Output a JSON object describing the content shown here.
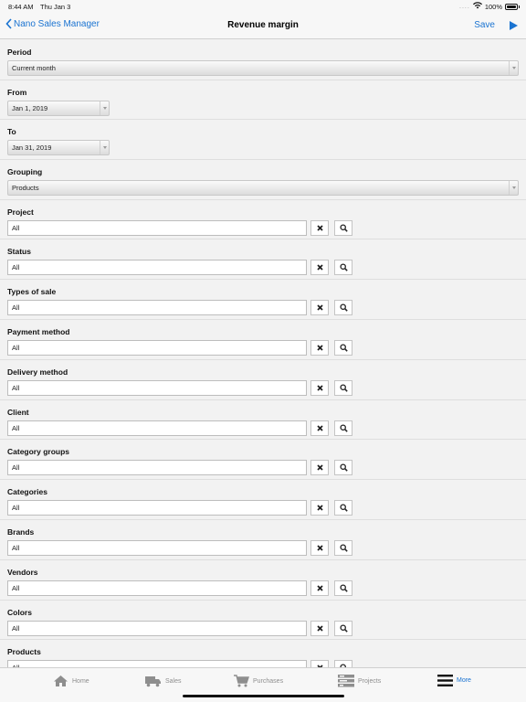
{
  "status_bar": {
    "time": "8:44 AM",
    "date": "Thu Jan 3",
    "battery": "100%"
  },
  "nav": {
    "back_label": "Nano Sales Manager",
    "title": "Revenue margin",
    "save_label": "Save"
  },
  "period": {
    "label": "Period",
    "value": "Current month"
  },
  "from": {
    "label": "From",
    "value": "Jan 1, 2019"
  },
  "to": {
    "label": "To",
    "value": "Jan 31, 2019"
  },
  "grouping": {
    "label": "Grouping",
    "value": "Products"
  },
  "filters": [
    {
      "label": "Project",
      "value": "All"
    },
    {
      "label": "Status",
      "value": "All"
    },
    {
      "label": "Types of sale",
      "value": "All"
    },
    {
      "label": "Payment method",
      "value": "All"
    },
    {
      "label": "Delivery method",
      "value": "All"
    },
    {
      "label": "Client",
      "value": "All"
    },
    {
      "label": "Category groups",
      "value": "All"
    },
    {
      "label": "Categories",
      "value": "All"
    },
    {
      "label": "Brands",
      "value": "All"
    },
    {
      "label": "Vendors",
      "value": "All"
    },
    {
      "label": "Colors",
      "value": "All"
    },
    {
      "label": "Products",
      "value": "All"
    }
  ],
  "tabs": [
    {
      "label": "Home",
      "icon": "house-icon"
    },
    {
      "label": "Sales",
      "icon": "truck-icon"
    },
    {
      "label": "Purchases",
      "icon": "cart-icon"
    },
    {
      "label": "Projects",
      "icon": "projects-icon"
    },
    {
      "label": "More",
      "icon": "menu-icon"
    }
  ],
  "colors": {
    "accent": "#1a73d1",
    "tab_inactive": "#8e8e8e",
    "background": "#f2f2f2"
  }
}
